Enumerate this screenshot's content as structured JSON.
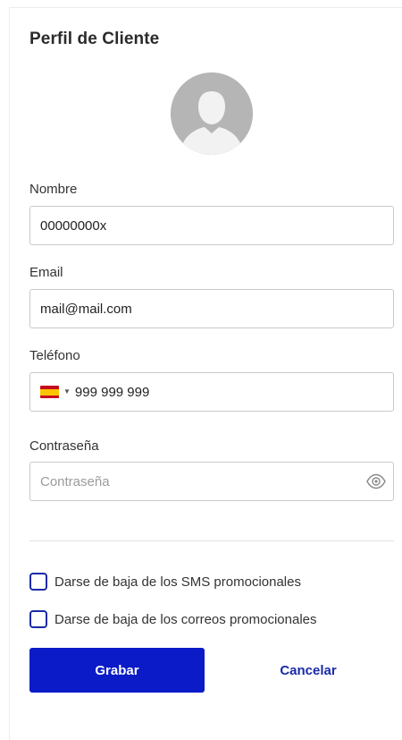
{
  "profile": {
    "title": "Perfil de Cliente",
    "avatar_icon": "user-avatar-icon"
  },
  "form": {
    "name_label": "Nombre",
    "name_value": "00000000x",
    "email_label": "Email",
    "email_value": "mail@mail.com",
    "phone_label": "Teléfono",
    "phone_country_icon": "spain-flag-icon",
    "phone_value": "999 999 999",
    "password_label": "Contraseña",
    "password_placeholder": "Contraseña",
    "password_toggle_icon": "eye-icon"
  },
  "options": {
    "unsubscribe_sms_label": "Darse de baja de los SMS promocionales",
    "unsubscribe_email_label": "Darse de baja de los correos promocionales",
    "unsubscribe_sms_checked": false,
    "unsubscribe_email_checked": false
  },
  "actions": {
    "save_label": "Grabar",
    "cancel_label": "Cancelar"
  },
  "colors": {
    "primary": "#0a1bc7",
    "link": "#1a2aa8",
    "avatar_bg": "#b5b5b5"
  }
}
